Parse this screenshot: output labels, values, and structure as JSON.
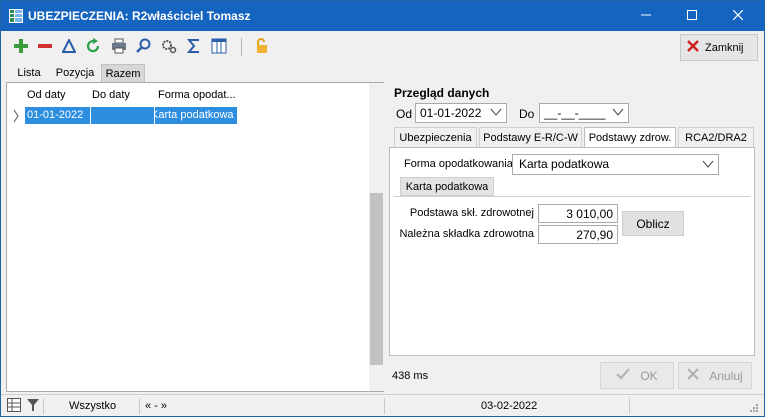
{
  "window": {
    "title": "UBEZPIECZENIA: R2właściciel Tomasz",
    "app_icon": "grid-app-icon",
    "title_bar_color": "#1565c0"
  },
  "toolbar": {
    "icons": [
      "add-icon",
      "remove-icon",
      "edit-icon",
      "refresh-icon",
      "print-icon",
      "search-icon",
      "settings-icon",
      "sum-icon",
      "columns-icon",
      "lock-icon"
    ],
    "close_label": "Zamknij"
  },
  "subtabs": [
    "Lista",
    "Pozycja",
    "Razem"
  ],
  "grid": {
    "columns": [
      "Od daty",
      "Do daty",
      "Forma opodat..."
    ],
    "rows": [
      {
        "od": "01-01-2022",
        "do": "",
        "forma": "Karta podatkowa"
      }
    ]
  },
  "review": {
    "title": "Przegląd danych",
    "od_label": "Od",
    "od_value": "01-01-2022",
    "do_label": "Do",
    "do_value": "__-__-____",
    "tabs": [
      "Ubezpieczenia",
      "Podstawy E-R/C-W",
      "Podstawy zdrow.",
      "RCA2/DRA2"
    ],
    "forma_label": "Forma opodatkowania",
    "forma_value": "Karta podatkowa",
    "inner_tab": "Karta podatkowa",
    "podstawa_label": "Podstawa skł. zdrowotnej",
    "podstawa_value": "3 010,00",
    "skladka_label": "Należna składka zdrowotna",
    "skladka_value": "270,90",
    "oblicz_label": "Oblicz",
    "timing": "438 ms",
    "ok_label": "OK",
    "anuluj_label": "Anuluj"
  },
  "status": {
    "filter_text": "Wszystko",
    "nav_text": "« - »",
    "date": "03-02-2022"
  }
}
